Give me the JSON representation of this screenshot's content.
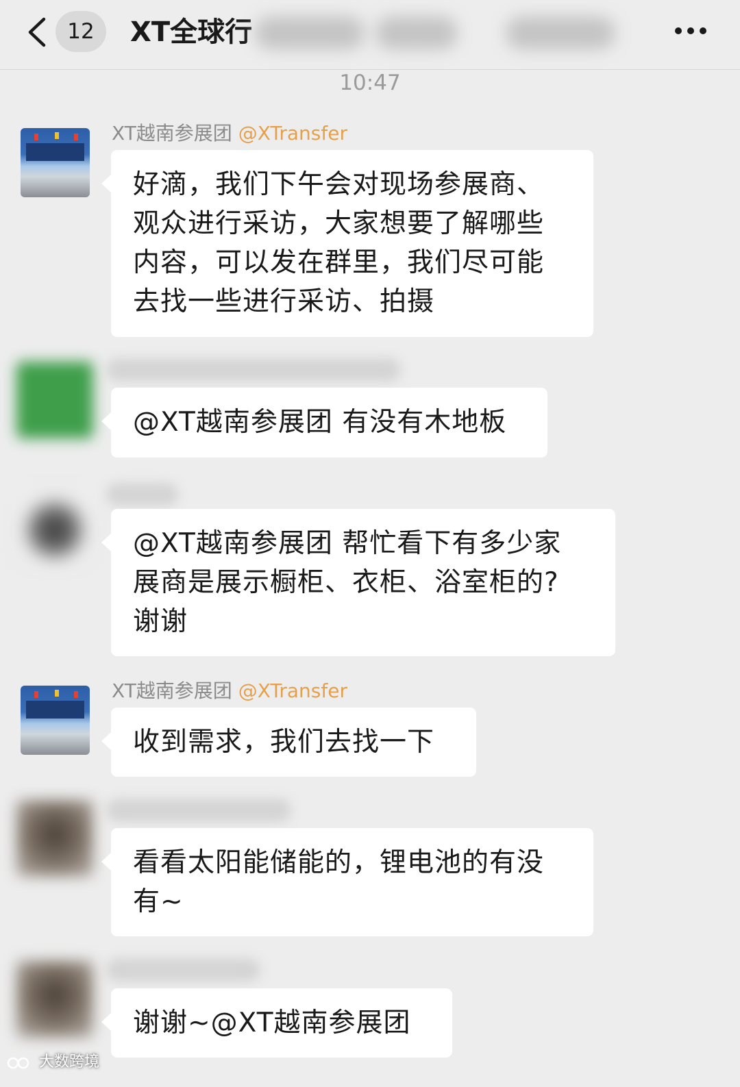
{
  "header": {
    "back_icon": "chevron-left-icon",
    "unread_count": "12",
    "title": "XT全球行",
    "more_icon": "ellipsis-icon"
  },
  "chat": {
    "timestamp": "10:47",
    "messages": [
      {
        "sender": "XT越南参展团",
        "handle": "@XTransfer",
        "lines": [
          "好滴，我们下午会对现场参展商、",
          "观众进行采访，大家想要了解哪些",
          "内容，可以发在群里，我们尽可能",
          "去找一些进行采访、拍摄"
        ]
      },
      {
        "sender": "",
        "handle": "",
        "lines": [
          "@XT越南参展团 有没有木地板"
        ]
      },
      {
        "sender": "",
        "handle": "",
        "lines": [
          "@XT越南参展团 帮忙看下有多少家",
          "展商是展示橱柜、衣柜、浴室柜的?",
          "谢谢"
        ]
      },
      {
        "sender": "XT越南参展团",
        "handle": "@XTransfer",
        "lines": [
          "收到需求，我们去找一下"
        ]
      },
      {
        "sender": "",
        "handle": "",
        "lines": [
          "看看太阳能储能的，锂电池的有没",
          "有~"
        ]
      },
      {
        "sender": "",
        "handle": "",
        "lines": [
          "谢谢~@XT越南参展团"
        ]
      }
    ]
  },
  "watermark": {
    "text": "大数跨境"
  },
  "colors": {
    "background": "#ededed",
    "bubble": "#ffffff",
    "handle": "#e6a04a",
    "meta_text": "#8b8b8b"
  }
}
